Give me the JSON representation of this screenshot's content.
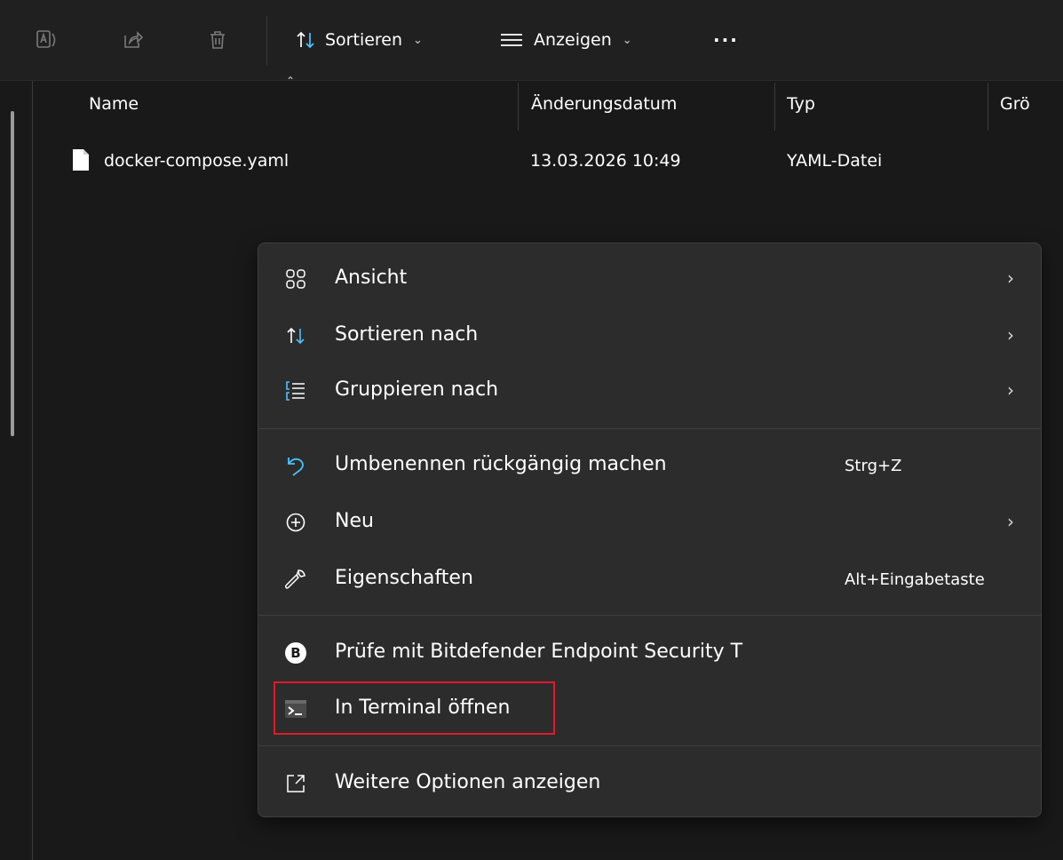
{
  "toolbar": {
    "icons": [
      "translate-icon",
      "share-icon",
      "delete-icon"
    ],
    "sort_label": "Sortieren",
    "view_label": "Anzeigen",
    "more_label": "···"
  },
  "columns": {
    "name": "Name",
    "modified": "Änderungsdatum",
    "type": "Typ",
    "size": "Grö"
  },
  "files": [
    {
      "name": "docker-compose.yaml",
      "modified": "13.03.2026 10:49",
      "type": "YAML-Datei"
    }
  ],
  "context_menu": {
    "items": [
      {
        "label": "Ansicht",
        "icon": "grid-icon",
        "submenu": "›"
      },
      {
        "label": "Sortieren nach",
        "icon": "sort-icon",
        "submenu": "›"
      },
      {
        "label": "Gruppieren nach",
        "icon": "group-icon",
        "submenu": "›"
      },
      {
        "label": "Umbenennen rückgängig machen",
        "icon": "undo-icon",
        "shortcut": "Strg+Z"
      },
      {
        "label": "Neu",
        "icon": "new-icon",
        "submenu": "›"
      },
      {
        "label": "Eigenschaften",
        "icon": "wrench-icon",
        "shortcut": "Alt+Eingabetaste"
      },
      {
        "label": "Prüfe mit Bitdefender Endpoint Security T",
        "icon": "bitdefender-icon",
        "badge": "B"
      },
      {
        "label": "In Terminal öffnen",
        "icon": "terminal-icon"
      },
      {
        "label": "Weitere Optionen anzeigen",
        "icon": "more-options-icon"
      }
    ]
  },
  "colors": {
    "accent": "#4cc2ff",
    "highlight": "#e0192b",
    "menu_bg": "#2c2c2c"
  }
}
